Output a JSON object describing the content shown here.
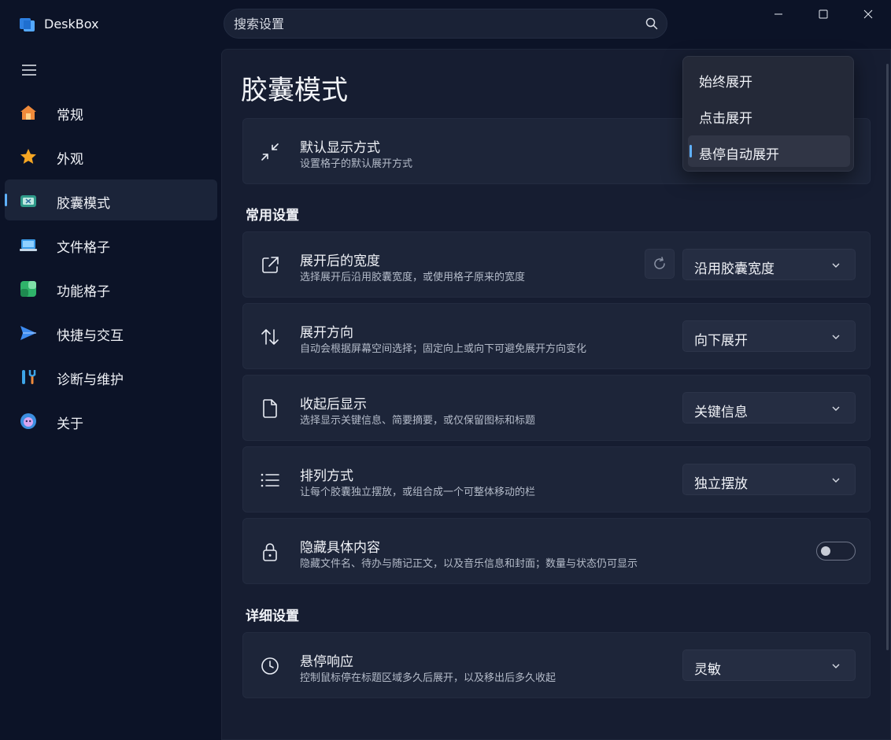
{
  "app": {
    "title": "DeskBox"
  },
  "search": {
    "placeholder": "搜索设置"
  },
  "sidebar": {
    "items": [
      {
        "label": "常规",
        "icon": "home-icon"
      },
      {
        "label": "外观",
        "icon": "star-icon"
      },
      {
        "label": "胶囊模式",
        "icon": "capsule-icon",
        "active": true
      },
      {
        "label": "文件格子",
        "icon": "laptop-icon"
      },
      {
        "label": "功能格子",
        "icon": "grid-icon"
      },
      {
        "label": "快捷与交互",
        "icon": "send-icon"
      },
      {
        "label": "诊断与维护",
        "icon": "tools-icon"
      },
      {
        "label": "关于",
        "icon": "bot-icon"
      }
    ]
  },
  "main": {
    "title": "胶囊模式",
    "default_display": {
      "title": "默认显示方式",
      "desc": "设置格子的默认展开方式"
    },
    "section_common": "常用设置",
    "width": {
      "title": "展开后的宽度",
      "desc": "选择展开后沿用胶囊宽度，或使用格子原来的宽度",
      "value": "沿用胶囊宽度"
    },
    "direction": {
      "title": "展开方向",
      "desc": "自动会根据屏幕空间选择；固定向上或向下可避免展开方向变化",
      "value": "向下展开"
    },
    "collapsed": {
      "title": "收起后显示",
      "desc": "选择显示关键信息、简要摘要，或仅保留图标和标题",
      "value": "关键信息"
    },
    "arrange": {
      "title": "排列方式",
      "desc": "让每个胶囊独立摆放，或组合成一个可整体移动的栏",
      "value": "独立摆放"
    },
    "hide": {
      "title": "隐藏具体内容",
      "desc": "隐藏文件名、待办与随记正文，以及音乐信息和封面；数量与状态仍可显示",
      "toggle_on": false
    },
    "section_detail": "详细设置",
    "hover": {
      "title": "悬停响应",
      "desc": "控制鼠标停在标题区域多久后展开，以及移出后多久收起",
      "value": "灵敏"
    }
  },
  "popup": {
    "options": [
      "始终展开",
      "点击展开",
      "悬停自动展开"
    ],
    "selected": "悬停自动展开"
  },
  "colors": {
    "accent": "#5fb1ff",
    "background": "#0c1327",
    "panel": "#161d31",
    "card": "#1d2539"
  }
}
